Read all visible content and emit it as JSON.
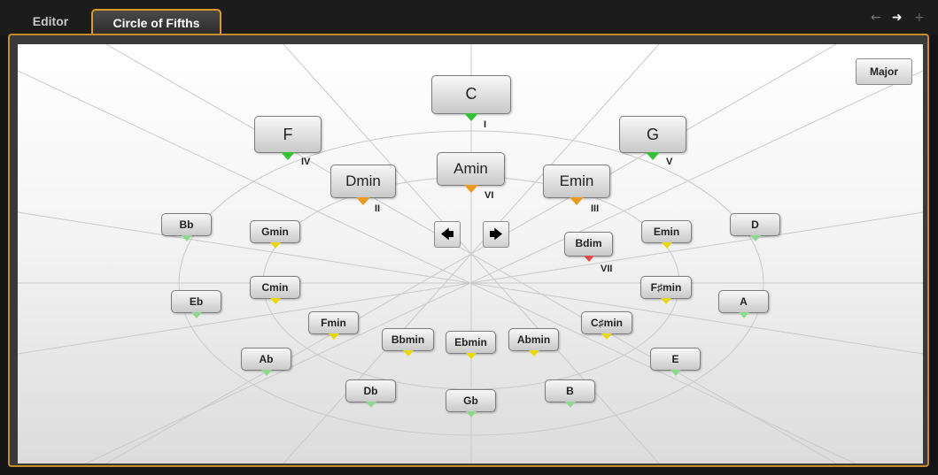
{
  "tabs": {
    "editor": "Editor",
    "circle_of_fifths": "Circle of Fifths"
  },
  "nav": {
    "back_icon": "←",
    "forward_icon": "➜",
    "add_icon": "+"
  },
  "mode_button": "Major",
  "arrows": {
    "left": "🡄",
    "right": "🡆"
  },
  "colors": {
    "panel_border": "#d99a2b",
    "tonic_marker": "#35c035",
    "relative_minor_marker": "#e89a22",
    "minor_marker": "#e8d800",
    "diminished_marker": "#e04848",
    "outer_marker": "#8ed88e"
  },
  "chords": {
    "c": "C",
    "f": "F",
    "g": "G",
    "dmin": "Dmin",
    "amin": "Amin",
    "emin_big": "Emin",
    "bb": "Bb",
    "gmin": "Gmin",
    "bdim": "Bdim",
    "emin_small": "Emin",
    "d": "D",
    "eb": "Eb",
    "cmin": "Cmin",
    "fsmin": "F♯min",
    "a": "A",
    "fmin": "Fmin",
    "csmin": "C♯min",
    "bbmin": "Bbmin",
    "ebmin": "Ebmin",
    "abmin": "Abmin",
    "ab": "Ab",
    "e": "E",
    "db": "Db",
    "gb": "Gb",
    "b": "B"
  },
  "degrees": {
    "i": "I",
    "iv": "IV",
    "v": "V",
    "ii": "II",
    "vi": "VI",
    "iii": "III",
    "vii": "VII"
  }
}
